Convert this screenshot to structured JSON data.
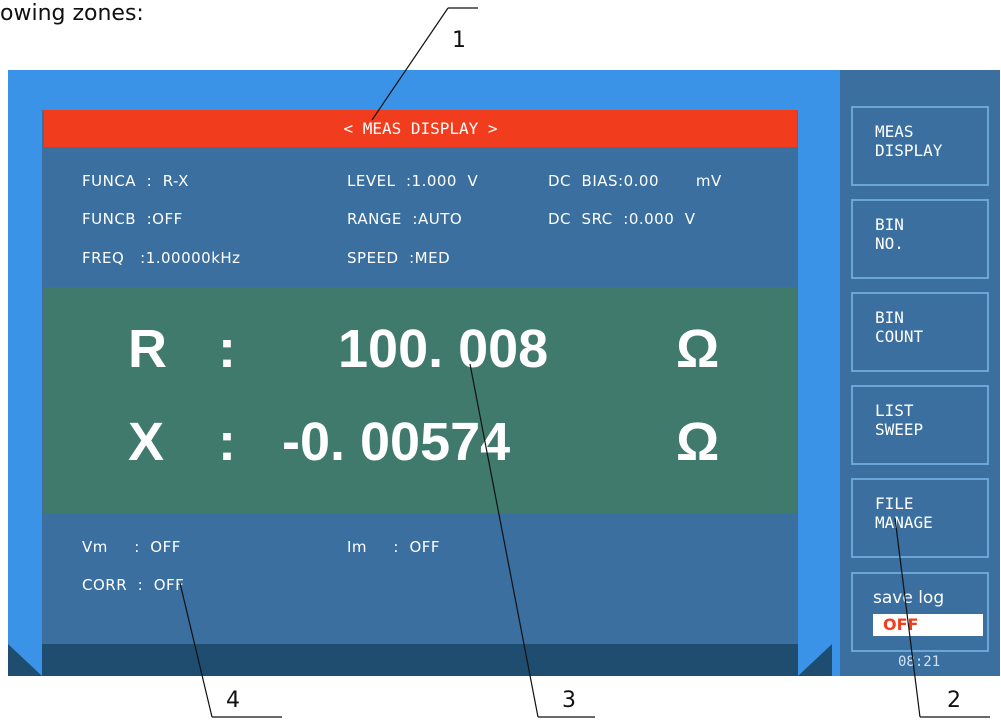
{
  "caption": "owing zones:",
  "instrument": {
    "title": "< MEAS DISPLAY >",
    "params": {
      "funca": "FUNCA  :  R-X",
      "funcb": "FUNCB  :OFF",
      "freq": "FREQ   :1.00000kHz",
      "level": "LEVEL  :1.000  V",
      "range": "RANGE  :AUTO",
      "speed": "SPEED  :MED",
      "dc_bias": "DC  BIAS:0.00       mV",
      "dc_src": "DC  SRC  :0.000  V"
    },
    "reading": {
      "primary_label": "R",
      "primary_sep": ":",
      "primary_value": "100. 008",
      "primary_unit": "Ω",
      "secondary_label": "X",
      "secondary_sep": ":",
      "secondary_value": "-0. 00574",
      "secondary_unit": "Ω"
    },
    "status": {
      "vm": "Vm     :  OFF",
      "im": "Im     :  OFF",
      "corr": "CORR  :  OFF"
    }
  },
  "softkeys": [
    {
      "label": "MEAS\nDISPLAY"
    },
    {
      "label": "BIN\nNO."
    },
    {
      "label": "BIN\nCOUNT"
    },
    {
      "label": "LIST\nSWEEP"
    },
    {
      "label": "FILE\nMANAGE"
    }
  ],
  "save_log": {
    "label": "save  log",
    "value": "OFF"
  },
  "clock": "08:21",
  "callouts": {
    "c1": "1",
    "c2": "2",
    "c3": "3",
    "c4": "4"
  },
  "colors": {
    "screen_blue": "#3b93e8",
    "panel": "#3a6f9f",
    "title_red": "#f23c1e",
    "reading_bg": "#3f7a6d"
  }
}
